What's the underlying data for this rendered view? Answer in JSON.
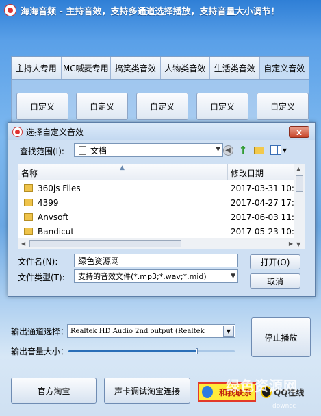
{
  "app": {
    "title": "海海音频 - 主持音效，支持多通道选择播放，支持音量大小调节！"
  },
  "tabs": [
    {
      "label": "主持人专用"
    },
    {
      "label": "MC喊麦专用"
    },
    {
      "label": "搞笑类音效"
    },
    {
      "label": "人物类音效"
    },
    {
      "label": "生活类音效"
    },
    {
      "label": "自定义音效",
      "active": true
    }
  ],
  "custom_buttons": [
    "自定义",
    "自定义",
    "自定义",
    "自定义",
    "自定义"
  ],
  "dialog": {
    "title": "选择自定义音效",
    "close_label": "x",
    "lookin_label": "查找范围(I):",
    "lookin_value": "文档",
    "columns": {
      "name": "名称",
      "date": "修改日期"
    },
    "files": [
      {
        "name": "360js Files",
        "date": "2017-03-31 10:"
      },
      {
        "name": "4399",
        "date": "2017-04-27 17:3"
      },
      {
        "name": "Anvsoft",
        "date": "2017-06-03 11:5"
      },
      {
        "name": "Bandicut",
        "date": "2017-05-23 10:2"
      }
    ],
    "filename_label": "文件名(N):",
    "filename_value": "绿色资源网",
    "filetype_label": "文件类型(T):",
    "filetype_value": "支持的音效文件(*.mp3;*.wav;*.mid)",
    "open_label": "打开(O)",
    "cancel_label": "取消"
  },
  "output": {
    "channel_label": "输出通道选择：",
    "channel_value": "Realtek HD Audio 2nd output (Realtek",
    "volume_label": "输出音量大小：",
    "volume_level": 0.77,
    "stop_label": "停止播放"
  },
  "footer": {
    "taobao_label": "官方淘宝",
    "soundcard_label": "声卡调试淘宝连接",
    "contact_label": "和我联系",
    "qq_label": "QQ在线"
  },
  "watermark": {
    "text": "绿色资源网",
    "sub": "downcc"
  },
  "colors": {
    "accent": "#2f7fd6",
    "close": "#c8452a",
    "contact_bg": "#ffeb3b"
  }
}
